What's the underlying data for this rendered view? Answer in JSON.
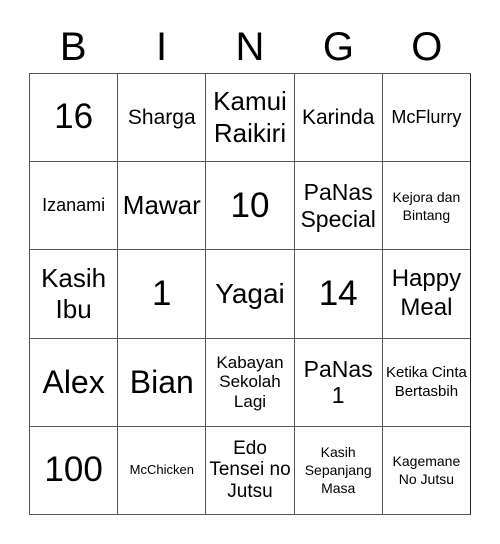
{
  "header": {
    "letters": [
      "B",
      "I",
      "N",
      "G",
      "O"
    ]
  },
  "board": {
    "rows": [
      [
        "16",
        "Sharga",
        "Kamui Raikiri",
        "Karinda",
        "McFlurry"
      ],
      [
        "Izanami",
        "Mawar",
        "10",
        "PaNas Special",
        "Kejora dan Bintang"
      ],
      [
        "Kasih Ibu",
        "1",
        "Yagai",
        "14",
        "Happy Meal"
      ],
      [
        "Alex",
        "Bian",
        "Kabayan Sekolah Lagi",
        "PaNas 1",
        "Ketika Cinta Bertasbih"
      ],
      [
        "100",
        "McChicken",
        "Edo Tensei no Jutsu",
        "Kasih Sepanjang Masa",
        "Kagemane No Jutsu"
      ]
    ]
  },
  "colors": {
    "grid_line": "#555555",
    "text": "#000000",
    "background": "#ffffff"
  }
}
